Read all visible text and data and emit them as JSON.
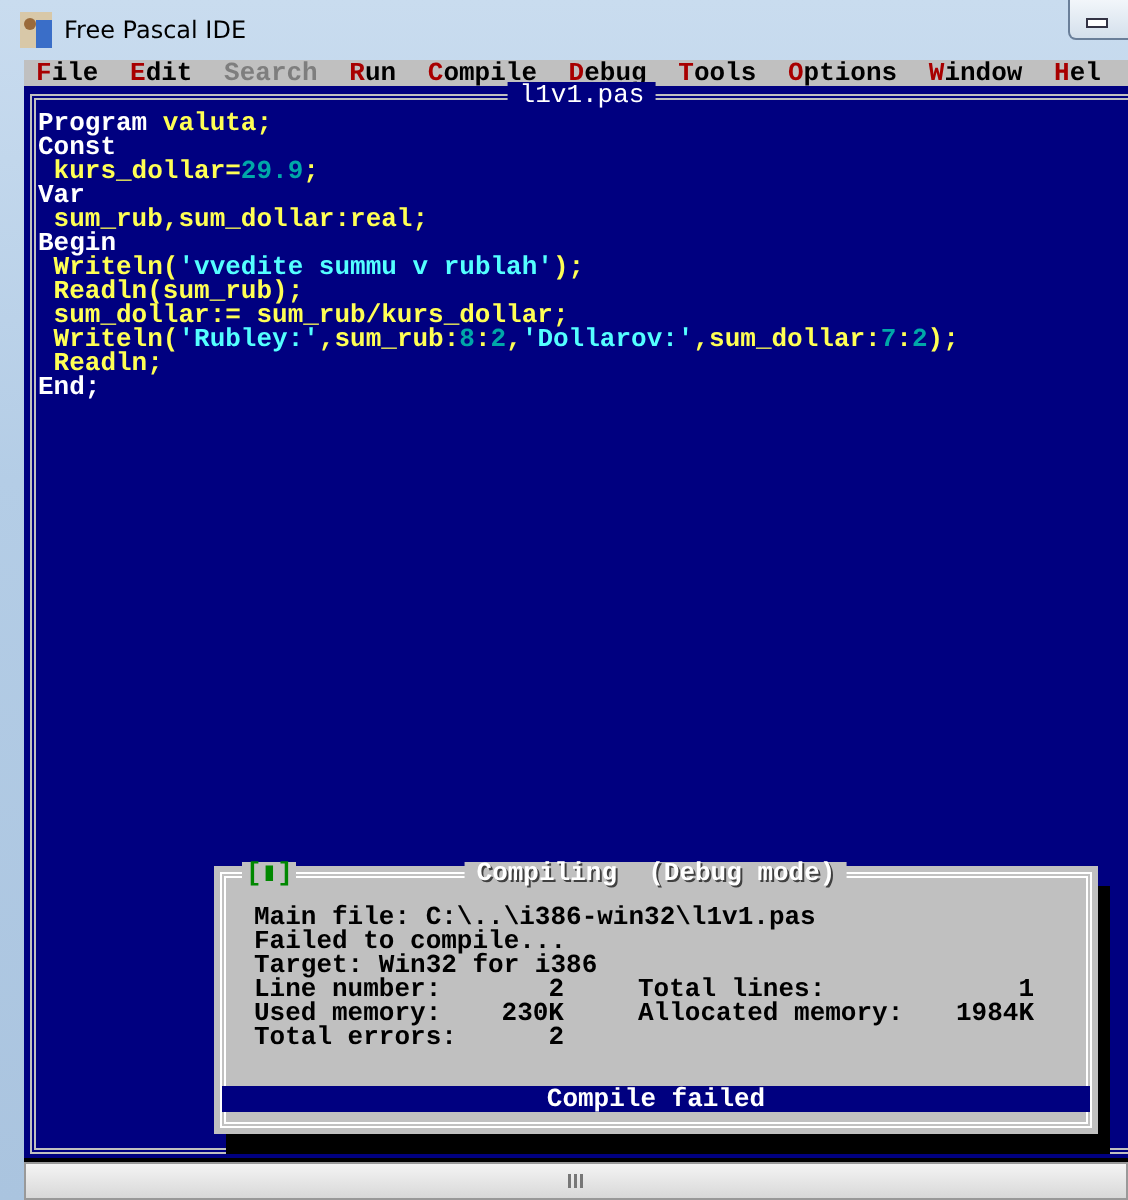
{
  "window": {
    "title": "Free Pascal IDE"
  },
  "menu": [
    {
      "label": "File",
      "disabled": false
    },
    {
      "label": "Edit",
      "disabled": false
    },
    {
      "label": "Search",
      "disabled": true
    },
    {
      "label": "Run",
      "disabled": false
    },
    {
      "label": "Compile",
      "disabled": false
    },
    {
      "label": "Debug",
      "disabled": false
    },
    {
      "label": "Tools",
      "disabled": false
    },
    {
      "label": "Options",
      "disabled": false
    },
    {
      "label": "Window",
      "disabled": false
    },
    {
      "label": "Hel",
      "disabled": false
    }
  ],
  "editor": {
    "title": "l1v1.pas",
    "lines": [
      [
        {
          "text": "Program",
          "kind": "keyword"
        },
        {
          "text": " valuta;",
          "kind": "ident"
        }
      ],
      [
        {
          "text": "Const",
          "kind": "keyword"
        }
      ],
      [
        {
          "text": " kurs_dollar=",
          "kind": "ident"
        },
        {
          "text": "29.9",
          "kind": "number"
        },
        {
          "text": ";",
          "kind": "ident"
        }
      ],
      [
        {
          "text": "Var",
          "kind": "keyword"
        }
      ],
      [
        {
          "text": " sum_rub,sum_dollar:real;",
          "kind": "ident"
        }
      ],
      [
        {
          "text": "Begin",
          "kind": "keyword"
        }
      ],
      [
        {
          "text": " Writeln(",
          "kind": "ident"
        },
        {
          "text": "'vvedite summu v rublah'",
          "kind": "string"
        },
        {
          "text": ");",
          "kind": "ident"
        }
      ],
      [
        {
          "text": " Readln(sum_rub);",
          "kind": "ident"
        }
      ],
      [
        {
          "text": " sum_dollar:= sum_rub/kurs_dollar;",
          "kind": "ident"
        }
      ],
      [
        {
          "text": " Writeln(",
          "kind": "ident"
        },
        {
          "text": "'Rubley:'",
          "kind": "string"
        },
        {
          "text": ",sum_rub:",
          "kind": "ident"
        },
        {
          "text": "8",
          "kind": "number"
        },
        {
          "text": ":",
          "kind": "ident"
        },
        {
          "text": "2",
          "kind": "number"
        },
        {
          "text": ",",
          "kind": "ident"
        },
        {
          "text": "'Dollarov:'",
          "kind": "string"
        },
        {
          "text": ",sum_dollar:",
          "kind": "ident"
        },
        {
          "text": "7",
          "kind": "number"
        },
        {
          "text": ":",
          "kind": "ident"
        },
        {
          "text": "2",
          "kind": "number"
        },
        {
          "text": ");",
          "kind": "ident"
        }
      ],
      [
        {
          "text": " Readln;",
          "kind": "ident"
        }
      ],
      [
        {
          "text": "End;",
          "kind": "keyword"
        }
      ]
    ]
  },
  "dialog": {
    "close": "[▮]",
    "title": "Compiling  (Debug mode)",
    "lines": [
      "Main file: C:\\..\\i386-win32\\l1v1.pas",
      "Failed to compile...",
      "Target: Win32 for i386"
    ],
    "stats": [
      [
        "Line number:",
        "2",
        "Total lines:",
        "1"
      ],
      [
        "Used memory:",
        "230K",
        "Allocated memory:",
        "1984K"
      ],
      [
        "Total errors:",
        "2"
      ]
    ],
    "status": "Compile failed"
  }
}
